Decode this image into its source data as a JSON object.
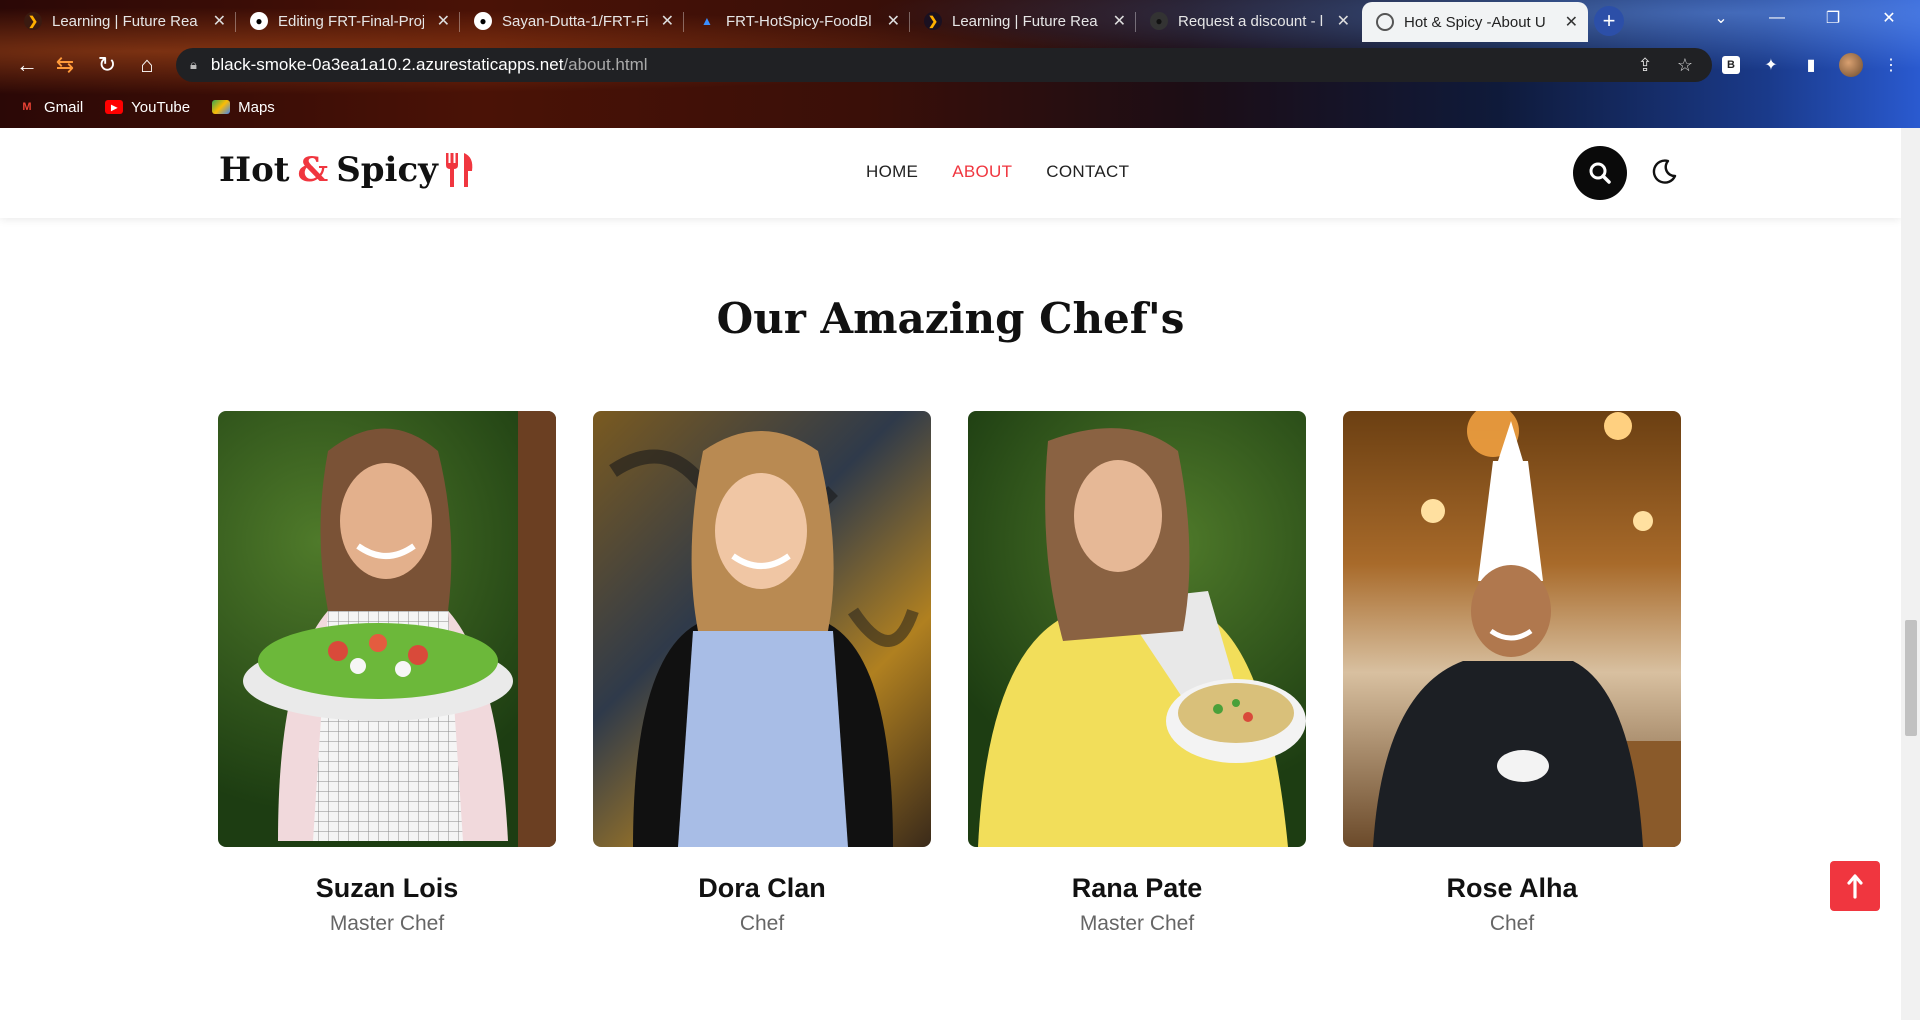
{
  "browser": {
    "tabs": [
      {
        "title": "Learning | Future Read",
        "favicon": "future-ready-icon"
      },
      {
        "title": "Editing FRT-Final-Proj",
        "favicon": "github-icon"
      },
      {
        "title": "Sayan-Dutta-1/FRT-Fi",
        "favicon": "github-icon"
      },
      {
        "title": "FRT-HotSpicy-FoodBl",
        "favicon": "azure-icon"
      },
      {
        "title": "Learning | Future Read",
        "favicon": "future-ready-icon"
      },
      {
        "title": "Request a discount - l",
        "favicon": "github-icon"
      },
      {
        "title": "Hot & Spicy -About U",
        "favicon": "globe-icon",
        "active": true
      }
    ],
    "url_host": "black-smoke-0a3ea1a10.2.azurestaticapps.net",
    "url_path": "/about.html",
    "bookmarks": [
      {
        "label": "Gmail",
        "icon": "gmail-icon"
      },
      {
        "label": "YouTube",
        "icon": "youtube-icon"
      },
      {
        "label": "Maps",
        "icon": "maps-icon"
      }
    ],
    "extension_badge": "B"
  },
  "site": {
    "brand": {
      "part1": "Hot",
      "amp": "&",
      "part2": "Spicy"
    },
    "nav": [
      {
        "label": "HOME",
        "active": false
      },
      {
        "label": "ABOUT",
        "active": true
      },
      {
        "label": "CONTACT",
        "active": false
      }
    ],
    "accent_color": "#f0363f",
    "section_title": "Our Amazing Chef's",
    "chefs": [
      {
        "name": "Suzan Lois",
        "role": "Master Chef"
      },
      {
        "name": "Dora Clan",
        "role": "Chef"
      },
      {
        "name": "Rana Pate",
        "role": "Master Chef"
      },
      {
        "name": "Rose Alha",
        "role": "Chef"
      }
    ],
    "back_to_top_icon": "arrow-up-icon"
  }
}
